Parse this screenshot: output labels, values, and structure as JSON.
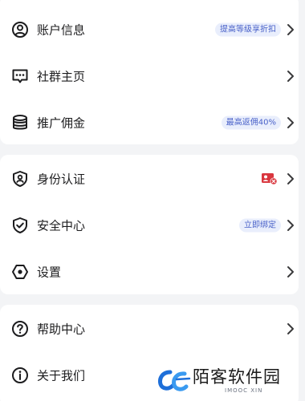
{
  "groups": [
    {
      "items": [
        {
          "label": "账户信息",
          "icon": "user-circle-icon",
          "badge": "提高等级享折扣"
        },
        {
          "label": "社群主页",
          "icon": "chat-bubble-icon",
          "badge": ""
        },
        {
          "label": "推广佣金",
          "icon": "coin-stack-icon",
          "badge": "最高返佣40%"
        }
      ]
    },
    {
      "items": [
        {
          "label": "身份认证",
          "icon": "id-shield-icon",
          "badge_icon": "unverified-badge-icon"
        },
        {
          "label": "安全中心",
          "icon": "shield-check-icon",
          "badge": "立即绑定"
        },
        {
          "label": "设置",
          "icon": "settings-hexagon-icon",
          "badge": ""
        }
      ]
    },
    {
      "items": [
        {
          "label": "帮助中心",
          "icon": "help-circle-icon",
          "badge": ""
        },
        {
          "label": "关于我们",
          "icon": "info-circle-icon",
          "badge": ""
        }
      ]
    }
  ],
  "watermark": {
    "text": "陌客软件园",
    "subtext": "IMOOC XIN"
  },
  "colors": {
    "background": "#f3f4f6",
    "card": "#ffffff",
    "text": "#1c1c1e",
    "badge_bg": "#e9eefc",
    "badge_text": "#4a62c9",
    "alert_red": "#d9363e",
    "watermark_blue": "#1e6fd9"
  }
}
